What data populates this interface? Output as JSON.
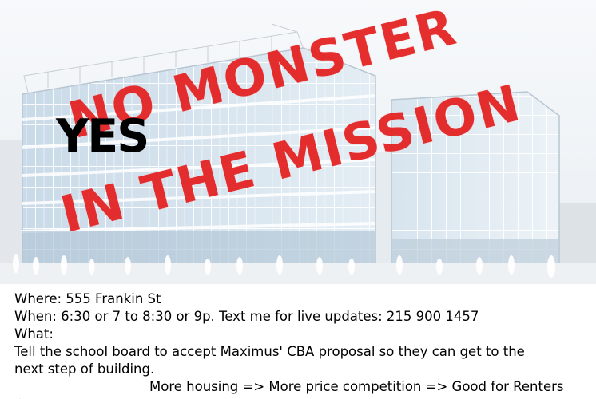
{
  "stamp": {
    "line1": "NO MONSTER",
    "line2": "IN THE MISSION",
    "color": "#e41f1f"
  },
  "overlay": {
    "yes": "YES"
  },
  "details": {
    "where": "Where: 555 Frankin St",
    "when": "When: 6:30 or 7 to 8:30 or 9p. Text me for live updates: 215 900 1457",
    "what": "What:",
    "tell_line1": "Tell the school board to accept Maximus' CBA proposal so they can get to the",
    "tell_line2": "next step of building.",
    "housing": "More housing => More price competition => Good for Renters",
    "cut_line": "↑"
  }
}
